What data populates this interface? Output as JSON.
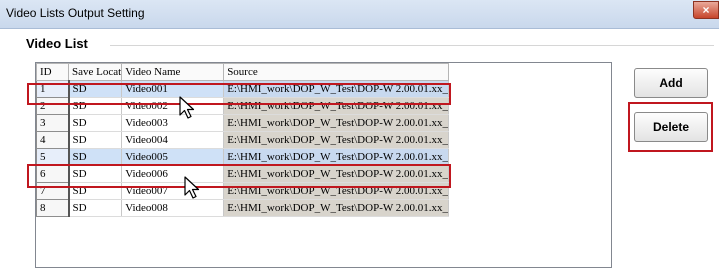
{
  "window": {
    "title": "Video Lists Output Setting",
    "close_glyph": "×"
  },
  "section": {
    "title": "Video List"
  },
  "table": {
    "columns": [
      "ID",
      "Save Locat",
      "Video Name",
      "Source"
    ],
    "rows": [
      {
        "id": "1",
        "save": "SD",
        "name": "Video001",
        "source": "E:\\HMI_work\\DOP_W_Test\\DOP-W 2.00.01.xx_",
        "selected": true
      },
      {
        "id": "2",
        "save": "SD",
        "name": "Video002",
        "source": "E:\\HMI_work\\DOP_W_Test\\DOP-W 2.00.01.xx_",
        "selected": false
      },
      {
        "id": "3",
        "save": "SD",
        "name": "Video003",
        "source": "E:\\HMI_work\\DOP_W_Test\\DOP-W 2.00.01.xx_",
        "selected": false
      },
      {
        "id": "4",
        "save": "SD",
        "name": "Video004",
        "source": "E:\\HMI_work\\DOP_W_Test\\DOP-W 2.00.01.xx_",
        "selected": false
      },
      {
        "id": "5",
        "save": "SD",
        "name": "Video005",
        "source": "E:\\HMI_work\\DOP_W_Test\\DOP-W 2.00.01.xx_",
        "selected": true
      },
      {
        "id": "6",
        "save": "SD",
        "name": "Video006",
        "source": "E:\\HMI_work\\DOP_W_Test\\DOP-W 2.00.01.xx_",
        "selected": false
      },
      {
        "id": "7",
        "save": "SD",
        "name": "Video007",
        "source": "E:\\HMI_work\\DOP_W_Test\\DOP-W 2.00.01.xx_",
        "selected": false
      },
      {
        "id": "8",
        "save": "SD",
        "name": "Video008",
        "source": "E:\\HMI_work\\DOP_W_Test\\DOP-W 2.00.01.xx_",
        "selected": false
      }
    ]
  },
  "buttons": {
    "add": "Add",
    "delete": "Delete"
  },
  "colors": {
    "highlight": "#c0171f",
    "selection": "#cfe1f7"
  },
  "icons": [
    "close-icon",
    "mouse-cursor-icon"
  ]
}
